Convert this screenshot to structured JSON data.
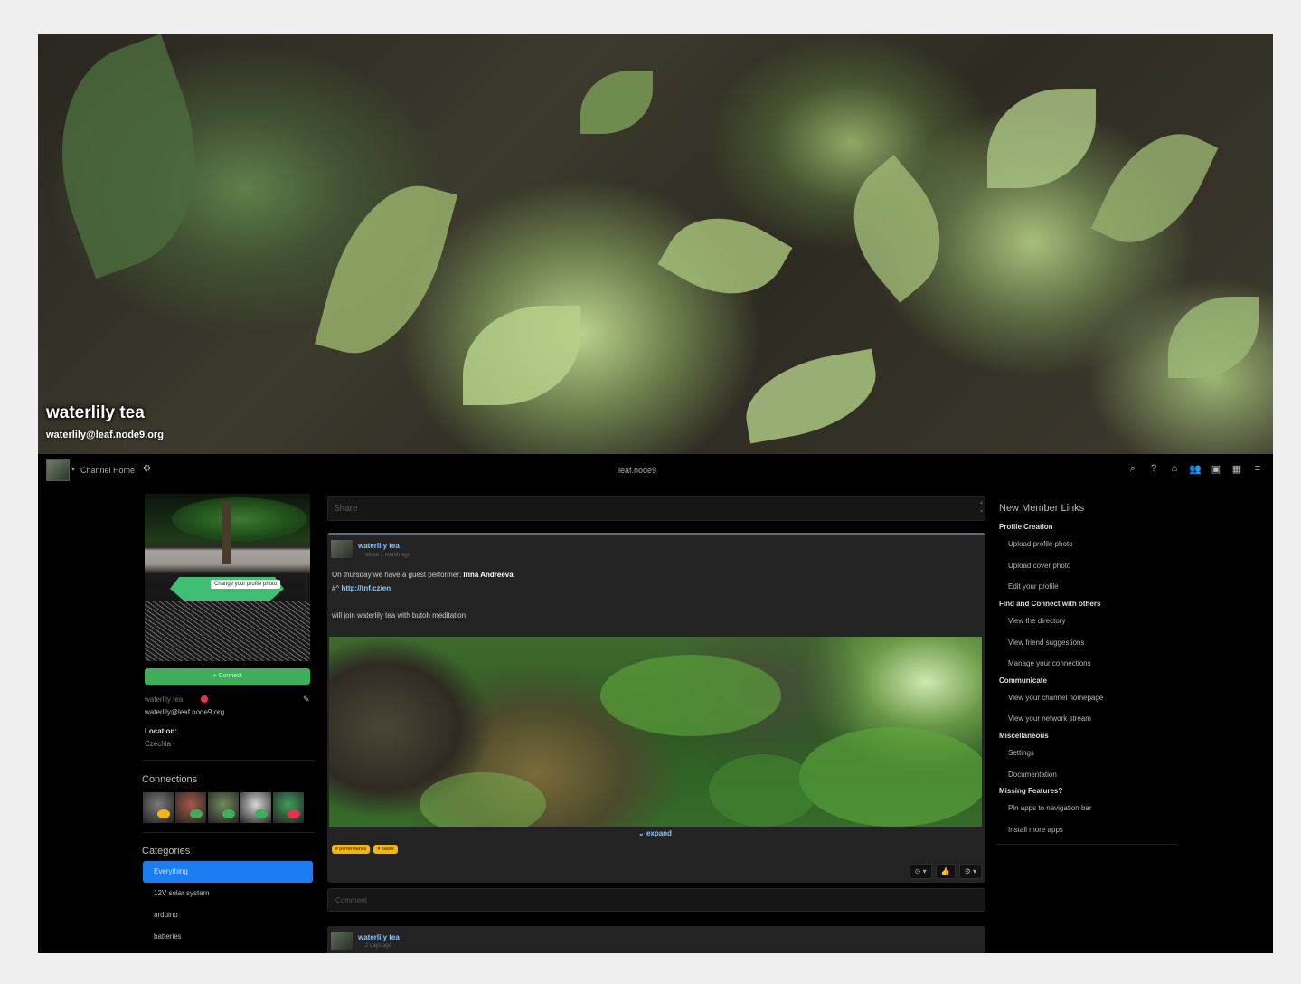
{
  "cover": {
    "name": "waterlily tea",
    "address": "waterlily@leaf.node9.org"
  },
  "navbar": {
    "channel_label": "Channel Home",
    "site_name": "leaf.node9",
    "icons": [
      "search-icon",
      "help-icon",
      "home-icon",
      "people-icon",
      "photo-icon",
      "apps-grid-icon",
      "menu-icon"
    ]
  },
  "profile": {
    "change_photo_label": "Change your profile photo",
    "connect_label": "+ Connect",
    "name": "waterlily tea",
    "address": "waterlily@leaf.node9.org",
    "location_label": "Location:",
    "location_value": "Czechia"
  },
  "connections": {
    "title": "Connections",
    "avatar_colors": [
      "#7a7a7a",
      "#a35a48",
      "#6f8a5b",
      "#d8d8d8",
      "#3f9e5a"
    ],
    "badge_colors": [
      "#f5b70e",
      "#3fae5b",
      "#3fae5b",
      "#3fae5b",
      "#e8314a"
    ]
  },
  "categories": {
    "title": "Categories",
    "items": [
      "Everything",
      "12V solar system",
      "arduino",
      "batteries"
    ],
    "active_index": 0
  },
  "share": {
    "placeholder": "Share"
  },
  "post": {
    "author": "waterlily tea",
    "time": "about 1 month ago",
    "line1_prefix": "On thursday we have a guest performer:",
    "line1_name": "Irina Andreeva",
    "link_prefix": "#^",
    "link": "http://tnf.cz/en",
    "line3": "will join waterlily tea with butoh meditation",
    "expand_label": "expand",
    "tags": [
      "# performance",
      "# butoh"
    ],
    "actions": [
      "⊙ ▾",
      "👍",
      "⚙ ▾"
    ]
  },
  "comment": {
    "placeholder": "Comment"
  },
  "post2": {
    "author": "waterlily tea",
    "time": "2 days ago"
  },
  "sidebar_right": {
    "title": "New Member Links",
    "sections": [
      {
        "title": "Profile Creation",
        "links": [
          "Upload profile photo",
          "Upload cover photo",
          "Edit your profile"
        ]
      },
      {
        "title": "Find and Connect with others",
        "links": [
          "View the directory",
          "View friend suggestions",
          "Manage your connections"
        ]
      },
      {
        "title": "Communicate",
        "links": [
          "View your channel homepage",
          "View your network stream"
        ]
      },
      {
        "title": "Miscellaneous",
        "links": [
          "Settings",
          "Documentation"
        ]
      },
      {
        "title": "Missing Features?",
        "links": [
          "Pin apps to navigation bar",
          "Install more apps"
        ]
      }
    ]
  }
}
